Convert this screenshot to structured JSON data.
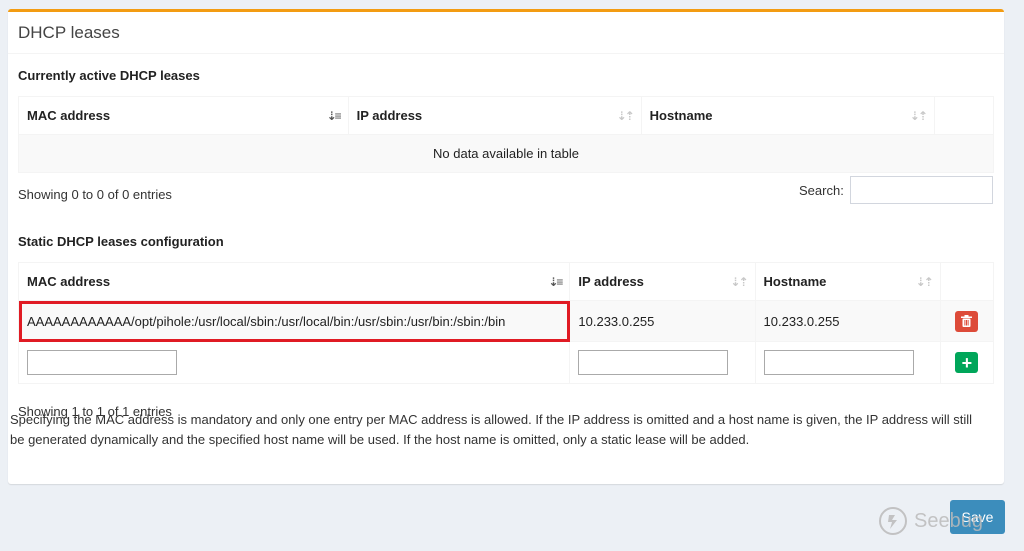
{
  "panel": {
    "title": "DHCP leases"
  },
  "active": {
    "title": "Currently active DHCP leases",
    "columns": [
      "MAC address",
      "IP address",
      "Hostname"
    ],
    "empty_message": "No data available in table",
    "info": "Showing 0 to 0 of 0 entries",
    "search_label": "Search:",
    "search_value": ""
  },
  "static": {
    "title": "Static DHCP leases configuration",
    "columns": [
      "MAC address",
      "IP address",
      "Hostname"
    ],
    "rows": [
      {
        "mac": "AAAAAAAAAAAA/opt/pihole:/usr/local/sbin:/usr/local/bin:/usr/sbin:/usr/bin:/sbin:/bin",
        "ip": "10.233.0.255",
        "hostname": "10.233.0.255"
      }
    ],
    "new_row": {
      "mac": "",
      "ip": "",
      "hostname": ""
    },
    "info": "Showing 1 to 1 of 1 entries",
    "help": "Specifying the MAC address is mandatory and only one entry per MAC address is allowed. If the IP address is omitted and a host name is given, the IP address will still be generated dynamically and the specified host name will be used. If the host name is omitted, only a static lease will be added."
  },
  "save_label": "Save",
  "watermark": "Seebug",
  "colors": {
    "accent_top": "#f39c12",
    "highlight": "#e01b24",
    "danger": "#dd4b39",
    "success": "#00a65a",
    "primary": "#3c8dbc"
  },
  "icons": {
    "sort_active": "sort-amount-asc-icon",
    "sort_inactive": "sort-both-icon",
    "delete": "trash-icon",
    "add": "plus-icon"
  }
}
